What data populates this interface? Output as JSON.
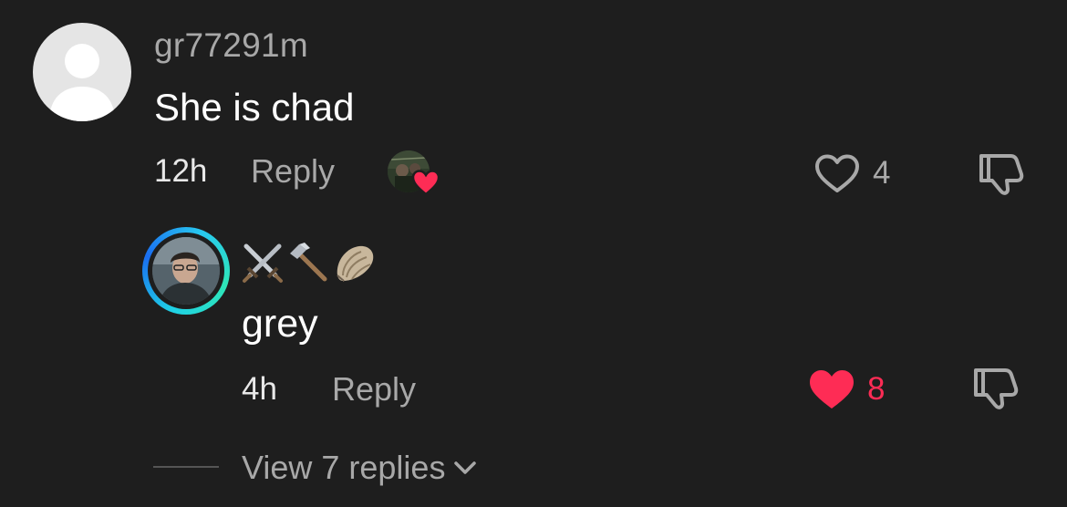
{
  "comment": {
    "username": "gr77291m",
    "text": "She is chad",
    "time": "12h",
    "reply_label": "Reply",
    "like_count": "4",
    "liked": false
  },
  "reply": {
    "username_emoji": [
      "crossed-swords",
      "hammer",
      "oyster"
    ],
    "text": "grey",
    "time": "4h",
    "reply_label": "Reply",
    "like_count": "8",
    "liked": true
  },
  "view_replies": {
    "label": "View 7 replies"
  },
  "colors": {
    "background": "#1e1e1e",
    "muted_text": "#a8a8a8",
    "like_red": "#fe2c55",
    "ring_gradient": [
      "#1fd1e6",
      "#1a6ef0",
      "#2ee6b8"
    ]
  }
}
